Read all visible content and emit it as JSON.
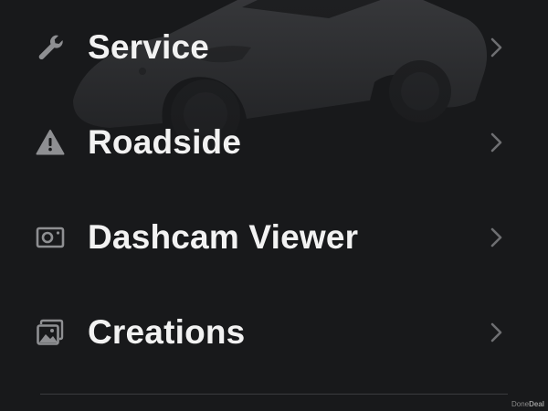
{
  "menu": {
    "items": [
      {
        "label": "Service",
        "icon": "wrench-icon"
      },
      {
        "label": "Roadside",
        "icon": "warning-triangle-icon"
      },
      {
        "label": "Dashcam Viewer",
        "icon": "dashcam-icon"
      },
      {
        "label": "Creations",
        "icon": "gallery-icon"
      }
    ]
  },
  "watermark": {
    "part1": "Done",
    "part2": "Deal"
  },
  "colors": {
    "background": "#18191b",
    "text": "#f2f2f2",
    "icon": "#8e8f92",
    "chevron": "#6e6f72",
    "divider": "#3a3b3e"
  }
}
